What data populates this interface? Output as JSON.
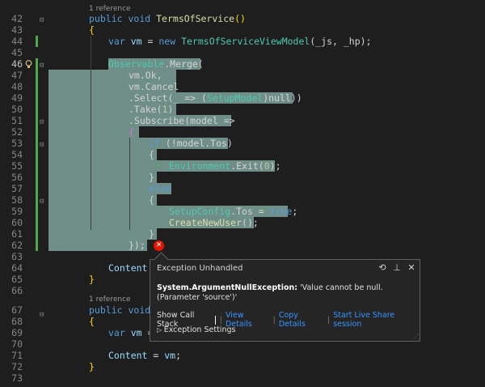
{
  "editor": {
    "ref_label": "1 reference",
    "line_numbers": [
      "42",
      "43",
      "44",
      "45",
      "46",
      "47",
      "48",
      "49",
      "50",
      "51",
      "52",
      "53",
      "54",
      "55",
      "56",
      "57",
      "58",
      "59",
      "60",
      "61",
      "62",
      "63",
      "64",
      "65",
      "66",
      "67",
      "68",
      "69",
      "70",
      "71",
      "72",
      "73"
    ],
    "current_line": "46"
  },
  "code": {
    "l42": {
      "k1": "public",
      "k2": "void",
      "fn": "TermsOfService",
      "paren": "()"
    },
    "l43": "{",
    "l44": {
      "kw": "var",
      "v": "vm",
      "eq": " = ",
      "new": "new",
      "ty": "TermsOfServiceViewModel",
      "args": "(_js, _hp);"
    },
    "l46": {
      "ty": "Observable",
      "rest": ".Merge("
    },
    "l47": "vm.Ok,",
    "l48": "vm.Cancel",
    "l49": {
      "a": ".Select(_ => (",
      "ty": "SetupModel",
      "b": ")null))"
    },
    "l50": {
      "a": ".Take(",
      "num": "1",
      "b": ")"
    },
    "l51": ".Subscribe(model =>",
    "l52": "{",
    "l53": {
      "kw": "if",
      "rest": " (!model.Tos)"
    },
    "l54": "{",
    "l55": {
      "ty": "Environment",
      "rest": ".Exit(",
      "num": "0",
      "end": ");"
    },
    "l56": "}",
    "l57": {
      "kw": "else"
    },
    "l58": "{",
    "l59": {
      "ty": "SetupConfig",
      "rest": ".Tos = ",
      "kw": "true",
      "end": ";"
    },
    "l60": {
      "fn": "CreateNewUser",
      "rest": "();"
    },
    "l61": "}",
    "l62": "});",
    "l64": "Content",
    "l65": "}",
    "l67": {
      "k1": "public",
      "k2": "void"
    },
    "l68": "{",
    "l69": {
      "kw": "var",
      "v": "vm",
      "eq": " ="
    },
    "l71": {
      "v": "Content",
      "eq": " = ",
      "vm": "vm",
      "end": ";"
    },
    "l72": "}"
  },
  "popup": {
    "title": "Exception Unhandled",
    "exception_type": "System.ArgumentNullException:",
    "exception_message": " 'Value cannot be null. (Parameter 'source')'",
    "show_call_stack": "Show Call Stack",
    "view_details": "View Details",
    "copy_details": "Copy Details",
    "live_share": "Start Live Share session",
    "settings": "Exception Settings",
    "icons": [
      "history-icon",
      "pin-icon",
      "close-icon"
    ]
  },
  "colors": {
    "keyword": "#569cd6",
    "type": "#4ec9b0",
    "method": "#dcdcaa",
    "selection": "#6f8e87",
    "error": "#e51400",
    "link": "#3794ff"
  }
}
